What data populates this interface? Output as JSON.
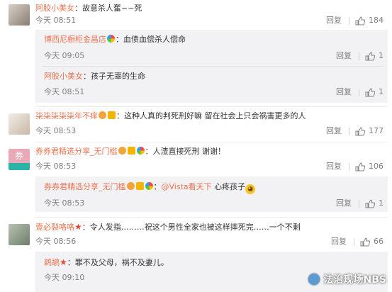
{
  "comments": [
    {
      "user": "阿胶小美女",
      "text": "：故意杀人奮~~死",
      "time": "今天 08:51",
      "reply_label": "回复",
      "likes": "184",
      "replies": [
        {
          "user": "博西尼橱柜金昌店",
          "text": "：血债血偿杀人偿命",
          "time": "今天 09:05",
          "reply_label": "回复",
          "likes": "1"
        },
        {
          "user": "阿胶小美女",
          "text": "：孩子无辜的生命",
          "time": "今天 08:51",
          "reply_label": "回复",
          "likes": "1"
        }
      ]
    },
    {
      "user": "柒柒柒柒柒年不痒",
      "text": "：这种人真的判死刑好嘛  留在社会上只会祸害更多的人",
      "time": "今天 08:53",
      "reply_label": "回复",
      "likes": "177"
    },
    {
      "user": "券券君精选分享_无门槛",
      "text": "：人渣直接死刑  谢谢！",
      "time": "今天 08:53",
      "reply_label": "回复",
      "likes": "106",
      "replies": [
        {
          "user": "券券君精选分享_无门槛",
          "mention": "@Vista看天下",
          "text": " 心疼孩子",
          "time": "今天 08:53",
          "reply_label": "回复",
          "likes": "1"
        }
      ]
    },
    {
      "user": "壹必裂咯咯",
      "text": "：令人发指………祝这个男性全家也被这样摔死完……一个不剩",
      "time": "今天 08:56",
      "reply_label": "回复",
      "likes": "66",
      "replies": [
        {
          "user": "鹈鹕",
          "text": "：罪不及父母，祸不及妻儿。",
          "time": "今天 09:10"
        }
      ]
    }
  ],
  "avatar3_text": "券",
  "watermark": "法治现场NBS",
  "colors": {
    "username": "#eb7350",
    "meta": "#808080",
    "reply_bg": "#f2f2f5"
  }
}
